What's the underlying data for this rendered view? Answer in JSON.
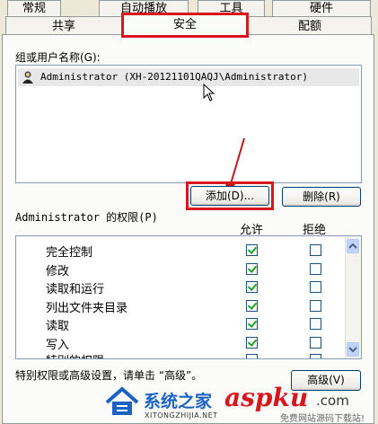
{
  "tabs_row1": [
    "常规",
    "自动播放",
    "工具",
    "硬件"
  ],
  "tabs_row2": [
    "共享",
    "安全",
    "配额"
  ],
  "groups_label": "组或用户名称(G):",
  "user_entry": "Administrator (XH-20121101QAQJ\\Administrator)",
  "buttons": {
    "add": "添加(D)...",
    "remove": "删除(R)",
    "advanced": "高级(V)"
  },
  "permissions": {
    "label": "Administrator 的权限(P)",
    "allow_header": "允许",
    "deny_header": "拒绝",
    "rows": [
      {
        "name": "完全控制",
        "allow": true,
        "deny": false
      },
      {
        "name": "修改",
        "allow": true,
        "deny": false
      },
      {
        "name": "读取和运行",
        "allow": true,
        "deny": false
      },
      {
        "name": "列出文件夹目录",
        "allow": true,
        "deny": false
      },
      {
        "name": "读取",
        "allow": true,
        "deny": false
      },
      {
        "name": "写入",
        "allow": true,
        "deny": false
      },
      {
        "name": "特别的权限",
        "allow": false,
        "deny": false
      }
    ]
  },
  "special_note": "特别权限或高级设置，请单击 “高级”。",
  "watermark": {
    "brand": "系统之家",
    "url": "XITONGZHIJIA.NET",
    "site": "aspku",
    "tld": ".com",
    "slogan": "免费网站源码下载站!"
  },
  "colors": {
    "highlight_red": "#d8161c",
    "check_green": "#21a121",
    "accent_blue": "#1b62c2"
  }
}
